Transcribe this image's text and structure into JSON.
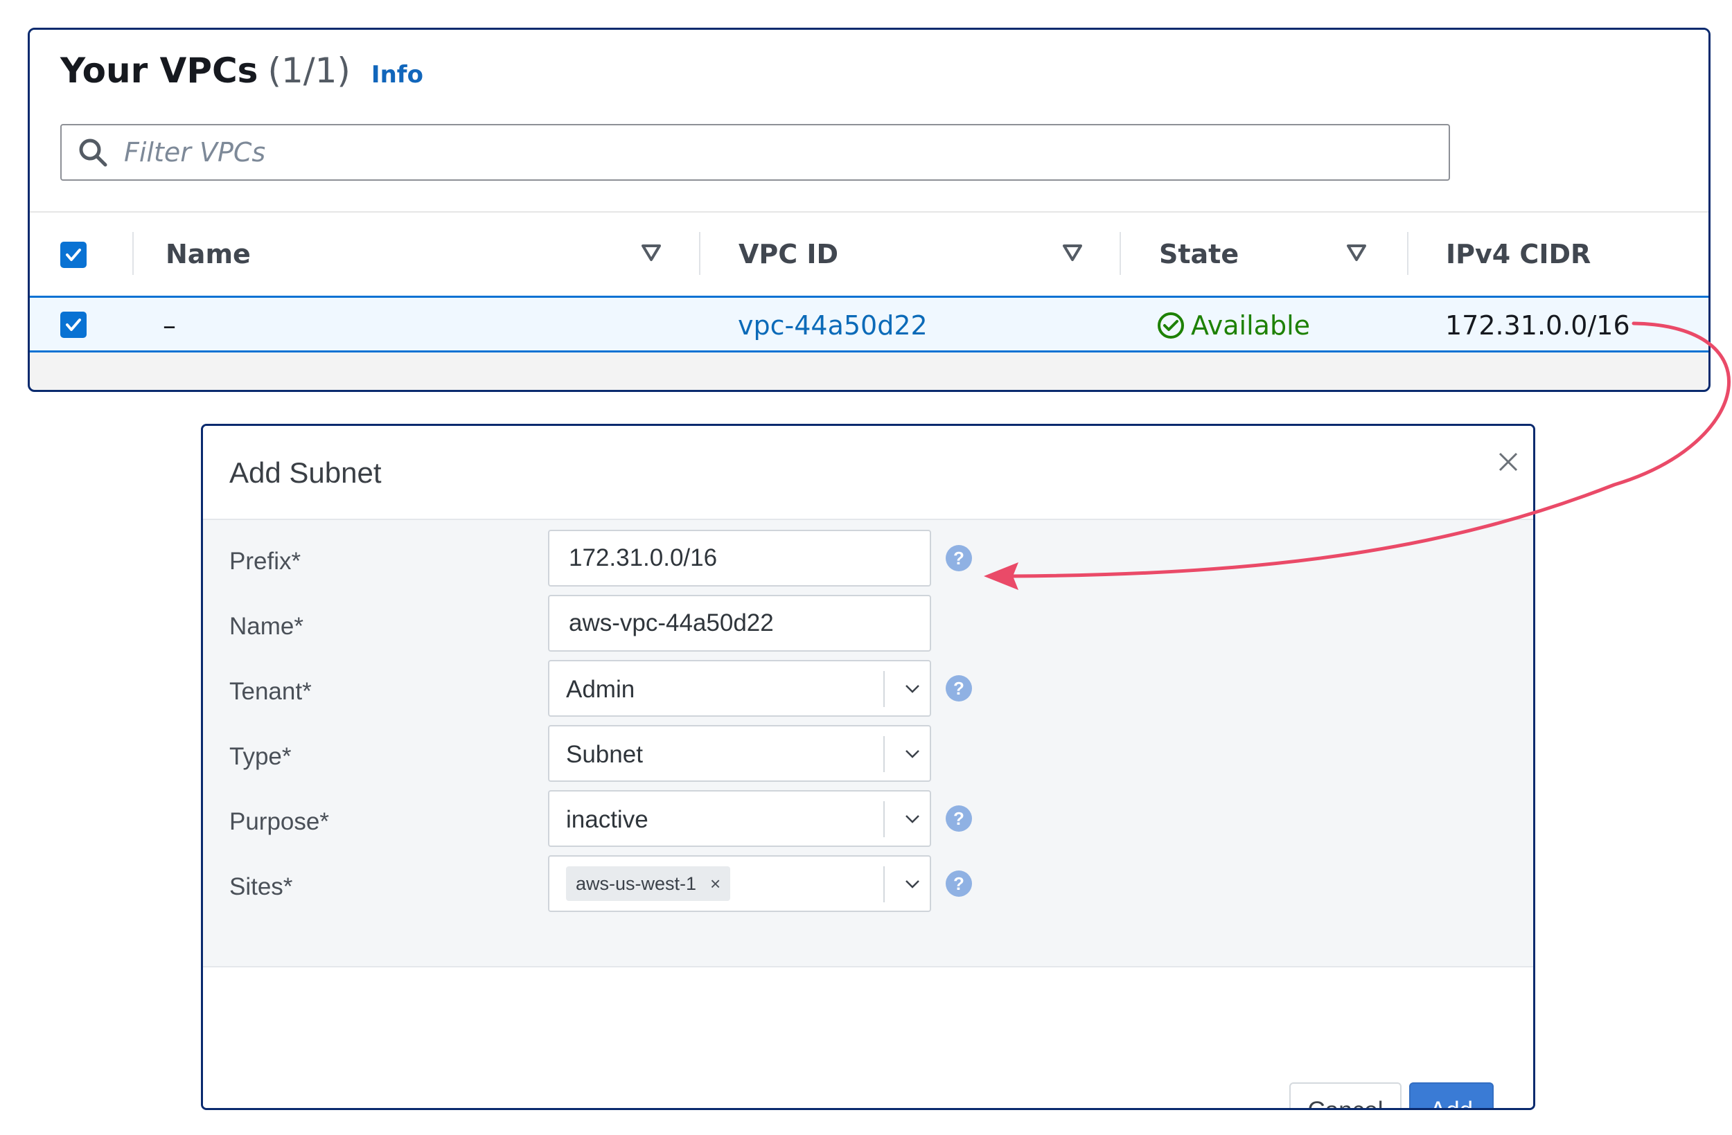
{
  "vpc_panel": {
    "title": "Your VPCs",
    "count": "(1/1)",
    "info_link": "Info",
    "filter_placeholder": "Filter VPCs",
    "columns": [
      "Name",
      "VPC ID",
      "State",
      "IPv4 CIDR"
    ],
    "rows": [
      {
        "name": "–",
        "vpc_id": "vpc-44a50d22",
        "state": "Available",
        "ipv4_cidr": "172.31.0.0/16",
        "selected": true
      }
    ],
    "colors": {
      "link": "#0b6ab8",
      "available": "#1d8102",
      "checkbox": "#0972d3"
    }
  },
  "dialog": {
    "title": "Add Subnet",
    "fields": {
      "prefix": {
        "label": "Prefix*",
        "value": "172.31.0.0/16"
      },
      "name": {
        "label": "Name*",
        "value": "aws-vpc-44a50d22"
      },
      "tenant": {
        "label": "Tenant*",
        "value": "Admin"
      },
      "type": {
        "label": "Type*",
        "value": "Subnet"
      },
      "purpose": {
        "label": "Purpose*",
        "value": "inactive"
      },
      "sites": {
        "label": "Sites*",
        "tag": "aws-us-west-1",
        "tag_remove": "×"
      }
    },
    "help_glyph": "?",
    "buttons": {
      "cancel": "Cancel",
      "add": "Add"
    },
    "colors": {
      "primary_button": "#3a7bd5",
      "help_icon": "#8fb1e3"
    }
  },
  "annotation": {
    "arrow_color": "#ea4a68",
    "arrow_from": "ipv4-cidr-cell",
    "arrow_to": "prefix-help-icon"
  }
}
